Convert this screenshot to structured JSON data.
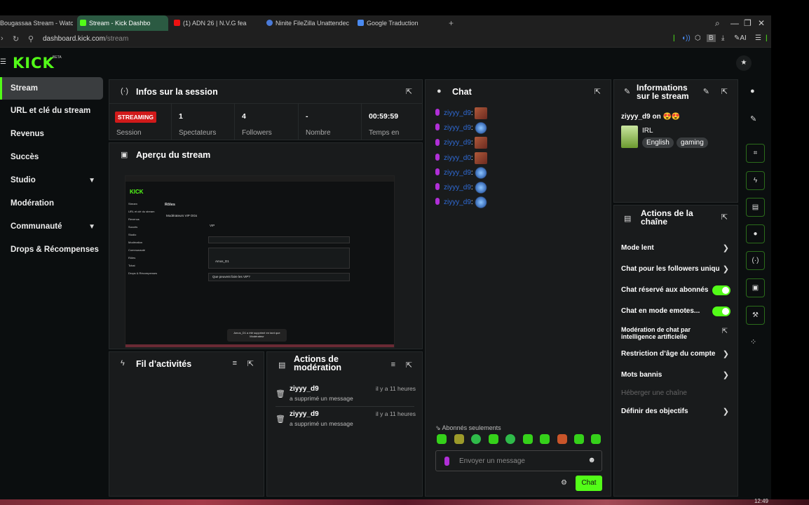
{
  "browser": {
    "tabs": [
      {
        "label": "Bougassaa Stream - Watc"
      },
      {
        "label": "Stream - Kick Dashbo"
      },
      {
        "label": "(1) ADN 26 | N.V.G fea"
      },
      {
        "label": "Ninite FileZilla Unattendec"
      },
      {
        "label": "Google Traduction"
      }
    ],
    "new_tab": "+",
    "url_domain": "dashboard.kick.com",
    "url_path": "/stream",
    "ai_label": "AI",
    "b_label": "B"
  },
  "header": {
    "logo": "KICK",
    "beta": "BETA",
    "star": "★"
  },
  "sidebar": {
    "items": [
      {
        "label": "Stream"
      },
      {
        "label": "URL et clé du stream"
      },
      {
        "label": "Revenus"
      },
      {
        "label": "Succès"
      },
      {
        "label": "Studio"
      },
      {
        "label": "Modération"
      },
      {
        "label": "Communauté"
      },
      {
        "label": "Drops & Récompenses"
      }
    ]
  },
  "session": {
    "title": "Infos sur la session",
    "live_badge": "STREAMING",
    "stats": [
      {
        "value": "",
        "label": "Session"
      },
      {
        "value": "1",
        "label": "Spectateurs"
      },
      {
        "value": "4",
        "label": "Followers"
      },
      {
        "value": "-",
        "label": "Nombre"
      },
      {
        "value": "00:59:59",
        "label": "Temps en"
      }
    ]
  },
  "preview": {
    "title": "Aperçu du stream",
    "inner_logo": "KICK",
    "inner_side": "Stream\nURL et clé du stream\nRevenus\nSuccès\nStudio\nModération\nCommunauté\nRôles\nTchat\nDrops & Récompenses",
    "inner_heading": "Rôles",
    "inner_tabs": "Modérateurs   VIP   OGs",
    "inner_vip": "VIP",
    "inner_user": "Amos_D1",
    "inner_question": "Que peuvent faire les VIP?",
    "inner_toast": "Amos_D1 a été supprimé en tant que Modérateur"
  },
  "activity": {
    "title": "Fil d’activités"
  },
  "modlog": {
    "title": "Actions de modération",
    "entries": [
      {
        "user": "ziyyy_d9",
        "time": "il y a 11 heures",
        "desc": "a supprimé un message"
      },
      {
        "user": "ziyyy_d9",
        "time": "il y a 11 heures",
        "desc": "a supprimé un message"
      }
    ]
  },
  "chat": {
    "title": "Chat",
    "messages": [
      {
        "user": "ziyyy_d9",
        "emote": "face"
      },
      {
        "user": "ziyyy_d9",
        "emote": "hand"
      },
      {
        "user": "ziyyy_d9",
        "emote": "face"
      },
      {
        "user": "ziyyy_d0",
        "emote": "face"
      },
      {
        "user": "ziyyy_d9",
        "emote": "hand"
      },
      {
        "user": "ziyyy_d9",
        "emote": "hand"
      },
      {
        "user": "ziyyy_d9",
        "emote": "hand"
      }
    ],
    "subs_only": "Abonnés seulements",
    "input_placeholder": "Envoyer un message",
    "send_label": "Chat"
  },
  "stream_info": {
    "title_line1": "Informations",
    "title_line2": "sur le stream",
    "stream_title": "ziyyy_d9 on 😍😍",
    "category": "IRL",
    "tags": [
      "English",
      "gaming"
    ]
  },
  "channel_actions": {
    "title_line1": "Actions de la",
    "title_line2": "chaîne",
    "items": [
      {
        "label": "Mode lent",
        "kind": "chevron"
      },
      {
        "label": "Chat pour les followers uniquement",
        "kind": "chevron"
      },
      {
        "label": "Chat réservé aux abonnés",
        "kind": "toggle",
        "on": true
      },
      {
        "label": "Chat en mode emotes...",
        "kind": "toggle",
        "on": true
      },
      {
        "label": "Modération de chat par intelligence artificielle",
        "kind": "external"
      },
      {
        "label": "Restriction d’âge du compte",
        "kind": "chevron"
      },
      {
        "label": "Mots bannis",
        "kind": "chevron"
      },
      {
        "label": "Héberger une chaîne",
        "kind": "disabled"
      },
      {
        "label": "Définir des objectifs",
        "kind": "chevron"
      }
    ]
  },
  "taskbar": {
    "clock": "12:49"
  },
  "colors": {
    "accent": "#53fc18",
    "live": "#d11a1a",
    "panel": "#191b1c",
    "mic": "#b02fd7",
    "username": "#2f6bd6"
  }
}
